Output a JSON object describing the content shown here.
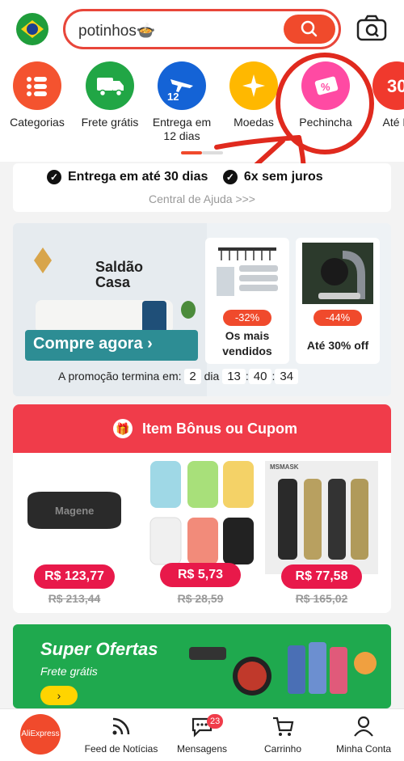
{
  "search": {
    "query": "potinhos🍲"
  },
  "categories": [
    {
      "label": "Categorias",
      "color": "#f4532f"
    },
    {
      "label": "Frete grátis",
      "color": "#21a645"
    },
    {
      "label": "Entrega em 12 dias",
      "color": "#1463d6",
      "badge": "12"
    },
    {
      "label": "Moedas",
      "color": "#ffb800"
    },
    {
      "label": "Pechincha",
      "color": "#ff4aa3"
    },
    {
      "label": "Até R",
      "color": "#f0392d",
      "badge": "30"
    }
  ],
  "info": {
    "perk1": "Entrega em até 30 dias",
    "perk2": "6x sem juros",
    "help": "Central de Ajuda >>>"
  },
  "promo": {
    "brand": "Saldão Casa",
    "cta": "Compre agora",
    "card1": {
      "discount": "-32%",
      "caption": "Os mais vendidos"
    },
    "card2": {
      "discount": "-44%",
      "caption": "Até 30% off"
    },
    "countdown": {
      "label": "A promoção termina em:",
      "days": "2",
      "days_label": "dia",
      "h": "13",
      "m": "40",
      "s": "34"
    }
  },
  "bonus": {
    "title": "Item Bônus ou Cupom",
    "products": [
      {
        "brand": "Magene",
        "price": "R$ 123,77",
        "old_price": "R$ 213,44"
      },
      {
        "price": "R$ 5,73",
        "old_price": "R$ 28,59"
      },
      {
        "brand": "MSMASK",
        "price": "R$ 77,58",
        "old_price": "R$ 165,02"
      }
    ]
  },
  "super": {
    "title": "Super Ofertas",
    "subtitle": "Frete grátis"
  },
  "tabs": [
    {
      "label": "AliExpress"
    },
    {
      "label": "Feed de Notícias"
    },
    {
      "label": "Mensagens",
      "badge": "23"
    },
    {
      "label": "Carrinho"
    },
    {
      "label": "Minha Conta"
    }
  ]
}
